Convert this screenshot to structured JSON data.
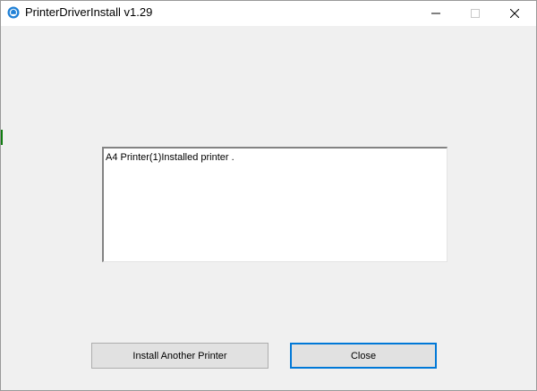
{
  "window": {
    "title": "PrinterDriverInstall v1.29"
  },
  "titlebar": {
    "icons": {
      "app": "app-icon",
      "minimize": "minimize-icon",
      "maximize": "maximize-icon",
      "close": "close-icon"
    }
  },
  "log": {
    "lines": [
      "A4 Printer(1)Installed printer ."
    ]
  },
  "buttons": {
    "install_another": "Install Another Printer",
    "close": "Close"
  },
  "colors": {
    "focus_border": "#0078d7",
    "window_bg": "#f0f0f0",
    "button_bg": "#e1e1e1",
    "app_icon": "#1f80d6"
  }
}
